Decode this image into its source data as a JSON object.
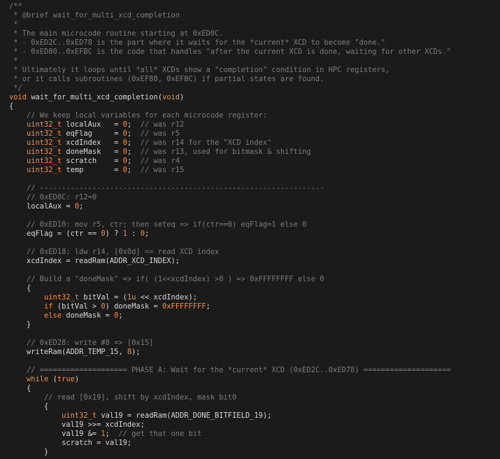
{
  "editor": {
    "colors": {
      "background": "#1b1b1c",
      "text": "#d8d8d8",
      "comment": "#7c7c80",
      "keyword": "#ff8d2c",
      "number": "#ff8d2c"
    },
    "lines": [
      [
        {
          "k": "comment",
          "t": "/**"
        }
      ],
      [
        {
          "k": "comment",
          "t": " * @brief wait_for_multi_xcd_completion"
        }
      ],
      [
        {
          "k": "comment",
          "t": " *"
        }
      ],
      [
        {
          "k": "comment",
          "t": " * The main microcode routine starting at 0xED0C."
        }
      ],
      [
        {
          "k": "comment",
          "t": " * - 0xED2C..0xED78 is the part where it waits for the *current* XCD to become \"done.\""
        }
      ],
      [
        {
          "k": "comment",
          "t": " * - 0xED80..0xEFBC is the code that handles \"after the current XCD is done, waiting for other XCDs.\""
        }
      ],
      [
        {
          "k": "comment",
          "t": " *"
        }
      ],
      [
        {
          "k": "comment",
          "t": " * Ultimately it loops until *all* XCDs show a \"completion\" condition in HPC registers,"
        }
      ],
      [
        {
          "k": "comment",
          "t": " * or it calls subroutines (0xEF88, 0xEFBC) if partial states are found."
        }
      ],
      [
        {
          "k": "comment",
          "t": " */"
        }
      ],
      [
        {
          "k": "kw",
          "t": "void"
        },
        {
          "k": "plain",
          "t": " wait_for_multi_xcd_completion("
        },
        {
          "k": "kw",
          "t": "void"
        },
        {
          "k": "plain",
          "t": ")"
        }
      ],
      [
        {
          "k": "plain",
          "t": "{"
        }
      ],
      [
        {
          "k": "plain",
          "t": "    "
        },
        {
          "k": "comment",
          "t": "// We keep local variables for each microcode register:"
        }
      ],
      [
        {
          "k": "plain",
          "t": "    "
        },
        {
          "k": "type",
          "t": "uint32_t"
        },
        {
          "k": "plain",
          "t": " localAux   = "
        },
        {
          "k": "num",
          "t": "0"
        },
        {
          "k": "plain",
          "t": ";  "
        },
        {
          "k": "comment",
          "t": "// was r12"
        }
      ],
      [
        {
          "k": "plain",
          "t": "    "
        },
        {
          "k": "type",
          "t": "uint32_t"
        },
        {
          "k": "plain",
          "t": " eqFlag     = "
        },
        {
          "k": "num",
          "t": "0"
        },
        {
          "k": "plain",
          "t": ";  "
        },
        {
          "k": "comment",
          "t": "// was r5"
        }
      ],
      [
        {
          "k": "plain",
          "t": "    "
        },
        {
          "k": "type",
          "t": "uint32_t"
        },
        {
          "k": "plain",
          "t": " xcdIndex   = "
        },
        {
          "k": "num",
          "t": "0"
        },
        {
          "k": "plain",
          "t": ";  "
        },
        {
          "k": "comment",
          "t": "// was r14 for the \"XCD index\""
        }
      ],
      [
        {
          "k": "plain",
          "t": "    "
        },
        {
          "k": "type",
          "t": "uint32_t"
        },
        {
          "k": "plain",
          "t": " doneMask   = "
        },
        {
          "k": "num",
          "t": "0"
        },
        {
          "k": "plain",
          "t": ";  "
        },
        {
          "k": "comment",
          "t": "// was r13, used for bitmask & shifting"
        }
      ],
      [
        {
          "k": "plain",
          "t": "    "
        },
        {
          "k": "type",
          "t": "uint32_t"
        },
        {
          "k": "plain",
          "t": " scratch    = "
        },
        {
          "k": "num",
          "t": "0"
        },
        {
          "k": "plain",
          "t": ";  "
        },
        {
          "k": "comment",
          "t": "// was r4"
        }
      ],
      [
        {
          "k": "plain",
          "t": "    "
        },
        {
          "k": "type",
          "t": "uint32_t"
        },
        {
          "k": "plain",
          "t": " temp       = "
        },
        {
          "k": "num",
          "t": "0"
        },
        {
          "k": "plain",
          "t": ";  "
        },
        {
          "k": "comment",
          "t": "// was r15"
        }
      ],
      [],
      [
        {
          "k": "plain",
          "t": "    "
        },
        {
          "k": "comment",
          "t": "// -----------------------------------------------------------------"
        }
      ],
      [
        {
          "k": "plain",
          "t": "    "
        },
        {
          "k": "comment",
          "t": "// 0xED0C: r12=0"
        }
      ],
      [
        {
          "k": "plain",
          "t": "    localAux = "
        },
        {
          "k": "num",
          "t": "0"
        },
        {
          "k": "plain",
          "t": ";"
        }
      ],
      [],
      [
        {
          "k": "plain",
          "t": "    "
        },
        {
          "k": "comment",
          "t": "// 0xED10: mov r5, ctr; then seteq => if(ctr==0) eqFlag=1 else 0"
        }
      ],
      [
        {
          "k": "plain",
          "t": "    eqFlag = (ctr == "
        },
        {
          "k": "num",
          "t": "0"
        },
        {
          "k": "plain",
          "t": ") ? "
        },
        {
          "k": "num",
          "t": "1"
        },
        {
          "k": "plain",
          "t": " : "
        },
        {
          "k": "num",
          "t": "0"
        },
        {
          "k": "plain",
          "t": ";"
        }
      ],
      [],
      [
        {
          "k": "plain",
          "t": "    "
        },
        {
          "k": "comment",
          "t": "// 0xED18: ldw r14, [0x0d] => read XCD index"
        }
      ],
      [
        {
          "k": "plain",
          "t": "    xcdIndex = readRam(ADDR_XCD_INDEX);"
        }
      ],
      [],
      [
        {
          "k": "plain",
          "t": "    "
        },
        {
          "k": "comment",
          "t": "// Build a \"doneMask\" => if( (1<<xcdIndex) >0 ) => 0xFFFFFFFF else 0"
        }
      ],
      [
        {
          "k": "plain",
          "t": "    {"
        }
      ],
      [
        {
          "k": "plain",
          "t": "        "
        },
        {
          "k": "type",
          "t": "uint32_t"
        },
        {
          "k": "plain",
          "t": " bitVal = ("
        },
        {
          "k": "num",
          "t": "1u"
        },
        {
          "k": "plain",
          "t": " << xcdIndex);"
        }
      ],
      [
        {
          "k": "plain",
          "t": "        "
        },
        {
          "k": "kw",
          "t": "if"
        },
        {
          "k": "plain",
          "t": " (bitVal > "
        },
        {
          "k": "num",
          "t": "0"
        },
        {
          "k": "plain",
          "t": ") doneMask = "
        },
        {
          "k": "num",
          "t": "0xFFFFFFFF"
        },
        {
          "k": "plain",
          "t": ";"
        }
      ],
      [
        {
          "k": "plain",
          "t": "        "
        },
        {
          "k": "kw",
          "t": "else"
        },
        {
          "k": "plain",
          "t": " doneMask = "
        },
        {
          "k": "num",
          "t": "0"
        },
        {
          "k": "plain",
          "t": ";"
        }
      ],
      [
        {
          "k": "plain",
          "t": "    }"
        }
      ],
      [],
      [
        {
          "k": "plain",
          "t": "    "
        },
        {
          "k": "comment",
          "t": "// 0xED28: write #8 => [0x15]"
        }
      ],
      [
        {
          "k": "plain",
          "t": "    writeRam(ADDR_TEMP_15, "
        },
        {
          "k": "num",
          "t": "8"
        },
        {
          "k": "plain",
          "t": ");"
        }
      ],
      [],
      [
        {
          "k": "plain",
          "t": "    "
        },
        {
          "k": "comment",
          "t": "// ==================== PHASE A: Wait for the *current* XCD (0xED2C..0xED78) ===================="
        }
      ],
      [
        {
          "k": "plain",
          "t": "    "
        },
        {
          "k": "kw",
          "t": "while"
        },
        {
          "k": "plain",
          "t": " ("
        },
        {
          "k": "kw",
          "t": "true"
        },
        {
          "k": "plain",
          "t": ")"
        }
      ],
      [
        {
          "k": "plain",
          "t": "    {"
        }
      ],
      [
        {
          "k": "plain",
          "t": "        "
        },
        {
          "k": "comment",
          "t": "// read [0x19], shift by xcdIndex, mask bit0"
        }
      ],
      [
        {
          "k": "plain",
          "t": "        {"
        }
      ],
      [
        {
          "k": "plain",
          "t": "            "
        },
        {
          "k": "type",
          "t": "uint32_t"
        },
        {
          "k": "plain",
          "t": " val19 = readRam(ADDR_DONE_BITFIELD_19);"
        }
      ],
      [
        {
          "k": "plain",
          "t": "            val19 >>= xcdIndex;"
        }
      ],
      [
        {
          "k": "plain",
          "t": "            val19 &= "
        },
        {
          "k": "num",
          "t": "1"
        },
        {
          "k": "plain",
          "t": ";  "
        },
        {
          "k": "comment",
          "t": "// get that one bit"
        }
      ],
      [
        {
          "k": "plain",
          "t": "            scratch = val19;"
        }
      ],
      [
        {
          "k": "plain",
          "t": "        }"
        }
      ]
    ]
  }
}
